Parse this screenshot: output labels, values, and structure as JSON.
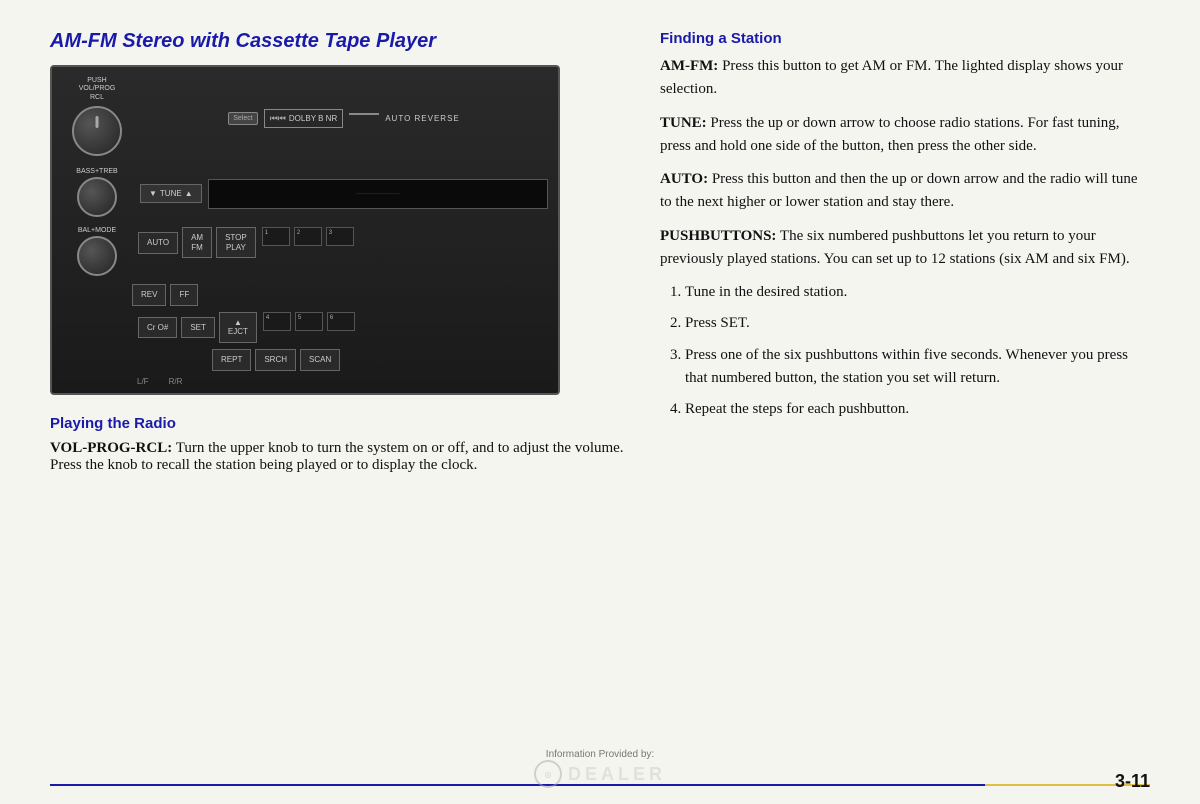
{
  "page": {
    "title": "AM-FM Stereo with Cassette Tape Player",
    "page_number": "3-11"
  },
  "left": {
    "title": "AM-FM Stereo with Cassette Tape Player",
    "playing_title": "Playing the Radio",
    "vol_prog_rcl_label": "VOL-PROG-RCL:",
    "vol_prog_rcl_text": "Turn the upper knob to turn the system on or off, and to adjust the volume. Press the knob to recall the station being played or to display the clock."
  },
  "right": {
    "finding_title": "Finding a Station",
    "amfm_label": "AM-FM:",
    "amfm_text": "Press this button to get AM or FM. The lighted display shows your selection.",
    "tune_label": "TUNE:",
    "tune_text": "Press the up or down arrow to choose radio stations. For fast tuning, press and hold one side of the button, then press the other side.",
    "auto_label": "AUTO:",
    "auto_text": "Press this button and then the up or down arrow and the radio will tune to the next higher or lower station and stay there.",
    "pushbuttons_label": "PUSHBUTTONS:",
    "pushbuttons_text": "The six numbered pushbuttons let you return to your previously played stations. You can set up to 12 stations (six AM and six FM).",
    "list_items": [
      "Tune in the desired station.",
      "Press SET.",
      "Press one of the six pushbuttons within five seconds. Whenever you press that numbered button, the station you set will return.",
      "Repeat the steps for each pushbutton."
    ]
  },
  "footer": {
    "provided_by": "Information Provided by:",
    "dealer_text": "DEALER",
    "page_number": "3-11"
  },
  "radio": {
    "vol_label": "PUSH\nVOL/PROG\nRCL",
    "select_label": "Select",
    "dolby_label": "DOLBY B NR",
    "auto_reverse_label": "AUTO REVERSE",
    "bass_label": "BASS+TREB",
    "tune_label": "TUNE",
    "auto_btn": "AUTO",
    "am_fm_btn": "AM\nFM",
    "stop_play_btn": "STOP\nPLAY",
    "rev_btn": "REV",
    "ff_btn": "FF",
    "btn1": "1",
    "btn2": "2",
    "btn3": "3",
    "bal_label": "BAL+MODE",
    "cro_btn": "Cr O#",
    "set_btn": "SET",
    "ejct_btn": "EJCT",
    "rept_btn": "REPT",
    "srch_btn": "SRCH",
    "scan_btn": "SCAN",
    "btn4": "4",
    "btn5": "5",
    "btn6": "6",
    "lf_label": "L/F",
    "rf_label": "R/R"
  }
}
